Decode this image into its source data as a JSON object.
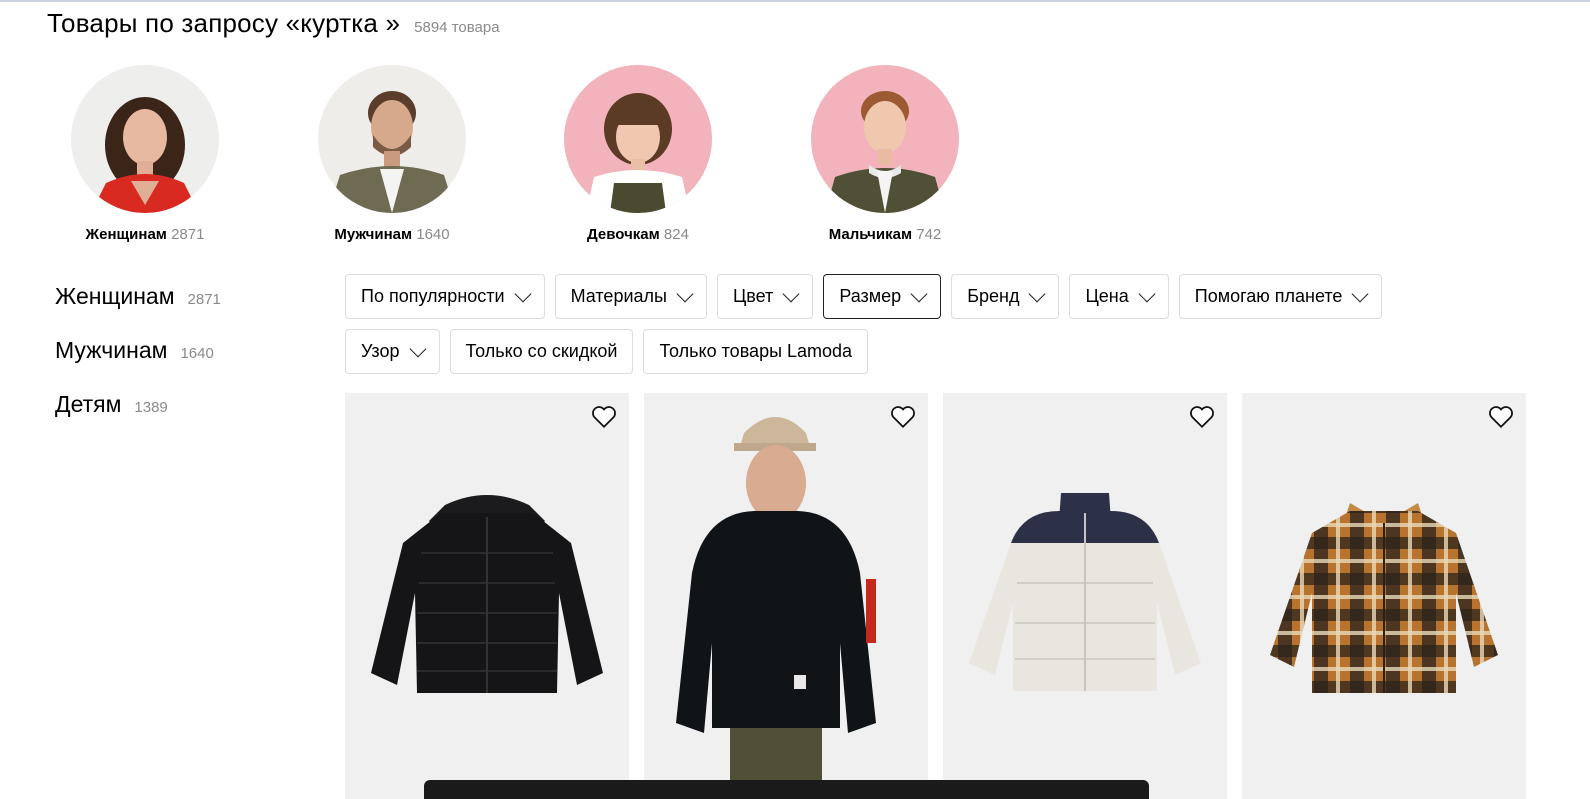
{
  "header": {
    "title": "Товары по запросу «куртка »",
    "count": "5894 товара"
  },
  "categories": [
    {
      "name": "Женщинам",
      "count": "2871"
    },
    {
      "name": "Мужчинам",
      "count": "1640"
    },
    {
      "name": "Девочкам",
      "count": "824"
    },
    {
      "name": "Мальчикам",
      "count": "742"
    }
  ],
  "sidebar": {
    "items": [
      {
        "label": "Женщинам",
        "count": "2871"
      },
      {
        "label": "Мужчинам",
        "count": "1640"
      },
      {
        "label": "Детям",
        "count": "1389"
      }
    ]
  },
  "filters": {
    "row1": [
      "По популярности",
      "Материалы",
      "Цвет",
      "Размер",
      "Бренд",
      "Цена",
      "Помогаю планете"
    ],
    "row2_dropdown": "Узор",
    "row2_toggles": [
      "Только со скидкой",
      "Только товары Lamoda"
    ],
    "active": "Размер"
  },
  "products": [
    {
      "image": "black-puffer-jacket",
      "favorite_icon": "heart-icon"
    },
    {
      "image": "man-in-black-jacket",
      "favorite_icon": "heart-icon"
    },
    {
      "image": "white-navy-puffer-jacket",
      "favorite_icon": "heart-icon"
    },
    {
      "image": "plaid-sherpa-shirt-jacket",
      "favorite_icon": "heart-icon"
    }
  ],
  "colors": {
    "accent_border": "#222222",
    "muted_text": "#8a8a8a",
    "card_bg": "#f0f0f1",
    "girl_bg": "#f2b3bd",
    "boy_bg": "#f2b3bd"
  }
}
